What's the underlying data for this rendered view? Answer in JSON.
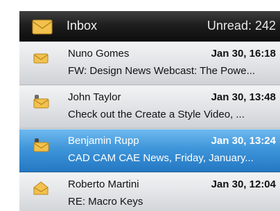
{
  "header": {
    "title": "Inbox",
    "unread": "Unread: 242",
    "icon": "envelope-icon"
  },
  "colors": {
    "header_bg": "#111111",
    "selected_bg": "#3f96da",
    "row_bg": "#e0e2e5",
    "envelope": "#f2c14e"
  },
  "messages": [
    {
      "sender": "Nuno Gomes",
      "date": "Jan 30, 16:18",
      "subject": "FW: Design News Webcast: The Powe...",
      "icon": "envelope-closed-icon",
      "selected": false
    },
    {
      "sender": "John Taylor",
      "date": "Jan 30, 13:48",
      "subject": "Check out the Create a Style Video, ...",
      "icon": "envelope-with-attachment-icon",
      "selected": false
    },
    {
      "sender": "Benjamin Rupp",
      "date": "Jan 30, 13:24",
      "subject": "CAD CAM CAE News, Friday, January...",
      "icon": "envelope-with-attachment-icon",
      "selected": true
    },
    {
      "sender": "Roberto Martini",
      "date": "Jan 30, 12:04",
      "subject": "RE: Macro Keys",
      "icon": "envelope-open-icon",
      "selected": false
    }
  ]
}
